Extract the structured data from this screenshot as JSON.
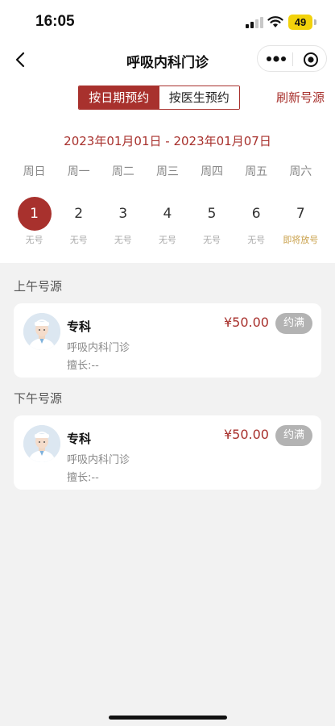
{
  "status_bar": {
    "time": "16:05",
    "battery": "49"
  },
  "nav": {
    "title": "呼吸内科门诊",
    "icons": [
      "back-icon",
      "more-icon",
      "close-circle-icon"
    ]
  },
  "tabs": [
    {
      "label": "按日期预约",
      "active": true
    },
    {
      "label": "按医生预约",
      "active": false
    }
  ],
  "refresh_label": "刷新号源",
  "date_range": "2023年01月01日 - 2023年01月07日",
  "weekdays": [
    "周日",
    "周一",
    "周二",
    "周三",
    "周四",
    "周五",
    "周六"
  ],
  "days": [
    {
      "num": "1",
      "sub": "无号",
      "selected": true
    },
    {
      "num": "2",
      "sub": "无号"
    },
    {
      "num": "3",
      "sub": "无号"
    },
    {
      "num": "4",
      "sub": "无号"
    },
    {
      "num": "5",
      "sub": "无号"
    },
    {
      "num": "6",
      "sub": "无号"
    },
    {
      "num": "7",
      "sub": "即将放号",
      "highlight_color": "#c9a04a"
    }
  ],
  "sections": [
    {
      "label": "上午号源",
      "doctor": {
        "title": "专科",
        "dept": "呼吸内科门诊",
        "skill": "擅长:--",
        "price": "¥50.00",
        "status": "约满"
      }
    },
    {
      "label": "下午号源",
      "doctor": {
        "title": "专科",
        "dept": "呼吸内科门诊",
        "skill": "擅长:--",
        "price": "¥50.00",
        "status": "约满"
      }
    }
  ],
  "colors": {
    "accent": "#a8312d",
    "badge_gray": "#b3b3b3",
    "background": "#f2f2f2"
  }
}
